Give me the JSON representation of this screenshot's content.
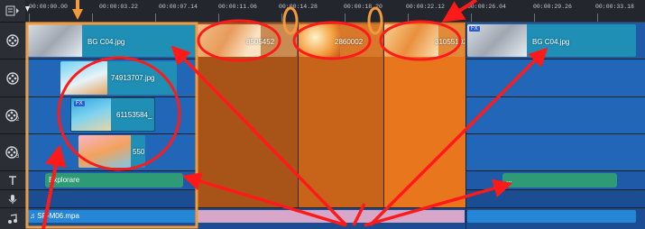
{
  "timeline": {
    "ruler_labels": [
      "00:00:00.00",
      "00:00:03.22",
      "00:00:07.14",
      "00:00:11.06",
      "00:00:14.28",
      "00:00:18.20",
      "00:00:22.12",
      "00:00:26.04",
      "00:00:29.26",
      "00:00:33.18"
    ],
    "track_icons": [
      "storyboard-toggle-icon",
      "video-track-icon",
      "overlay-track-1-icon",
      "overlay-track-2-icon",
      "overlay-track-3-icon",
      "title-track-icon",
      "voice-track-icon",
      "music-track-icon"
    ]
  },
  "video_track": {
    "clips": [
      {
        "name": "BG C04.jpg"
      },
      {
        "name": "8505452"
      },
      {
        "name": "2860002"
      },
      {
        "name": "31055102"
      },
      {
        "name": "BG C04.jpg",
        "badge": "FX"
      }
    ]
  },
  "overlay_tracks": [
    {
      "clip_name": "74913707.jpg"
    },
    {
      "clip_name": "61153584_",
      "badge": "FX"
    },
    {
      "clip_name": "550"
    }
  ],
  "title_track": {
    "clips": [
      "Explorare",
      "..."
    ]
  },
  "music_track": {
    "clip_name": "SP-M06.mpa"
  },
  "colors": {
    "clip_teal": "#1f8fb5",
    "lane_blue": "#2266b8",
    "transition_orange": "#e8761c",
    "annotation_red": "#ff1a1a",
    "annotation_orange": "#f39a3a",
    "title_green": "#2f9a76"
  }
}
